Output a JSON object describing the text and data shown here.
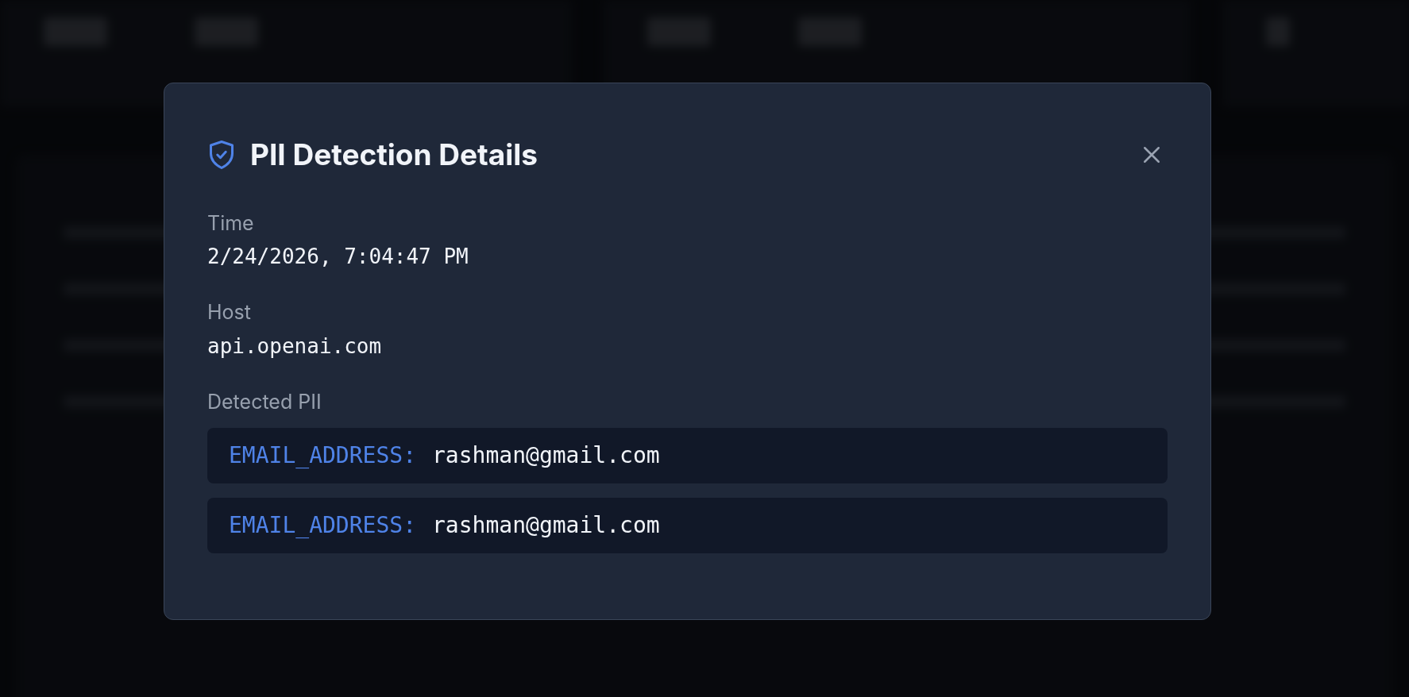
{
  "dialog": {
    "title": "PII Detection Details",
    "fields": [
      {
        "label": "Time",
        "value": "2/24/2026, 7:04:47 PM"
      },
      {
        "label": "Host",
        "value": "api.openai.com"
      }
    ],
    "pii_label": "Detected PII",
    "detections": [
      {
        "type": "EMAIL_ADDRESS:",
        "value": "rashman@gmail.com"
      },
      {
        "type": "EMAIL_ADDRESS:",
        "value": "rashman@gmail.com"
      }
    ]
  }
}
